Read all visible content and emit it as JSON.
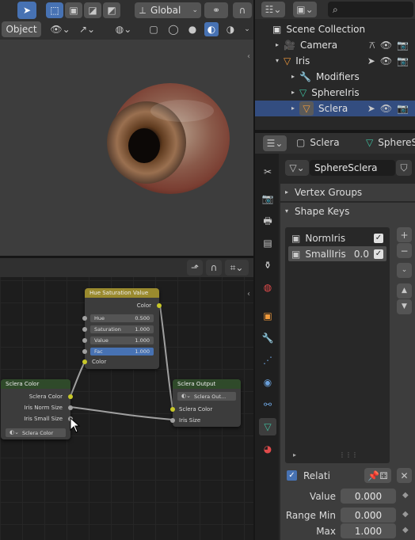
{
  "viewport": {
    "mode": "Object",
    "transform_orientation": "Global"
  },
  "outliner": {
    "collection": "Scene Collection",
    "items": [
      {
        "label": "Camera"
      },
      {
        "label": "Iris"
      },
      {
        "label": "Modifiers"
      },
      {
        "label": "SphereIris"
      },
      {
        "label": "Sclera"
      }
    ]
  },
  "properties": {
    "object_name": "Sclera",
    "mesh_tab": "SphereS",
    "data_name": "SphereSclera",
    "vertex_groups": "Vertex Groups",
    "shape_keys": "Shape Keys",
    "keys": [
      {
        "name": "NormIris",
        "value": ""
      },
      {
        "name": "SmallIris",
        "value": "0.0"
      }
    ],
    "relative_label": "Relati",
    "value_label": "Value",
    "value": "0.000",
    "range_min_label": "Range Min",
    "range_min": "0.000",
    "max_label": "Max",
    "max": "1.000"
  },
  "nodes": {
    "hsv": {
      "title": "Hue Saturation Value",
      "out_color": "Color",
      "hue_label": "Hue",
      "hue": "0.500",
      "sat_label": "Saturation",
      "sat": "1.000",
      "val_label": "Value",
      "val": "1.000",
      "fac_label": "Fac",
      "fac": "1.000",
      "in_color": "Color"
    },
    "sclera_color": {
      "title": "Sclera Color",
      "out1": "Sclera Color",
      "out2": "Iris Norm Size",
      "out3": "Iris Small Size",
      "material": "Sclera Color"
    },
    "sclera_output": {
      "title": "Sclera Output",
      "material": "Sclera Out...",
      "in1": "Sclera Color",
      "in2": "Iris Size"
    }
  },
  "colors": {
    "accent": "#4772b3",
    "yellow_socket": "#c7c729",
    "grey_socket": "#a1a1a1"
  }
}
